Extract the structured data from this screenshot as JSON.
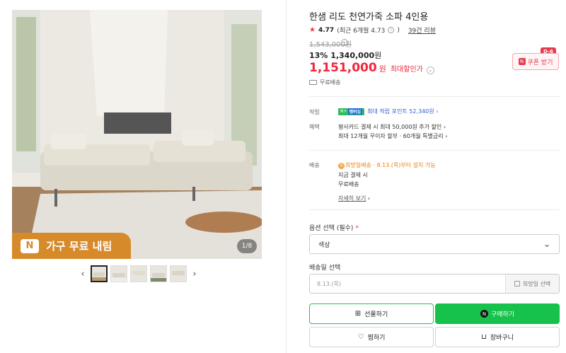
{
  "product": {
    "title": "한샘 리도 천연가죽 소파 4인용",
    "rating_score": "4.77",
    "rating_detail": "(최근 6개월 4.73",
    "review_count": "39건 리뷰",
    "original_price": "1,543,000원",
    "discount_rate": "13%",
    "discount_price": "1,340,000",
    "discount_won": "원",
    "best_price": "1,151,000",
    "best_won": "원",
    "best_label": "최대할인가",
    "shipping_summary": "무료배송",
    "coupon_label": "쿠폰 받기",
    "dday": "D-6"
  },
  "gallery": {
    "badge_text": "가구 무료 내림",
    "counter": "1/8",
    "thumbnails": [
      "thumb-1",
      "thumb-2",
      "thumb-3",
      "thumb-4",
      "thumb-5"
    ]
  },
  "benefits": {
    "points_label": "적립",
    "npay_text": "N+",
    "npay_sub": "멤버십",
    "points_text": "최대 적립 포인트 52,340원",
    "benefit_label": "혜택",
    "benefit_1": "평사카드 결제 시 최대 50,000원 추가 할인",
    "benefit_2": "최대 12개월 무이자 할부 · 60개월 특별금리"
  },
  "delivery": {
    "label": "배송",
    "hope_badge": "희망일배송",
    "hope_text": "· 8.13.(목)부터 설치 가능",
    "line_1": "지금 결제 시",
    "line_2": "무료배송",
    "more_link": "자세히 보기"
  },
  "options": {
    "label": "옵션 선택 (필수)",
    "required_mark": "*",
    "select_value": "색상",
    "date_label": "배송일 선택",
    "date_placeholder": "8.13.(목)",
    "date_button": "희망일 선택"
  },
  "actions": {
    "gift": "선물하기",
    "buy": "구매하기",
    "wish": "찜하기",
    "cart": "장바구니"
  },
  "colors": {
    "accent_red": "#f0263d",
    "naver_green": "#16c24b",
    "badge_orange": "#d78a2a"
  }
}
